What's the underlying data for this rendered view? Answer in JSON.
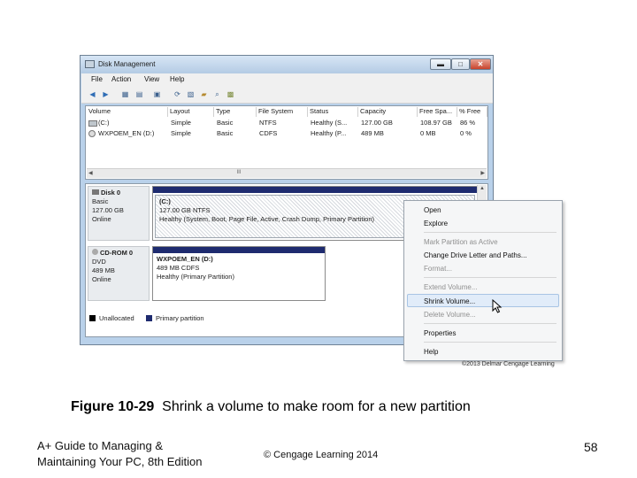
{
  "window": {
    "title": "Disk Management",
    "buttons": {
      "minimize": "▬",
      "maximize": "□",
      "close": "✕"
    }
  },
  "menu": [
    "File",
    "Action",
    "View",
    "Help"
  ],
  "toolbar_icons": [
    "back-icon",
    "forward-icon",
    "disk-list-icon",
    "properties-icon",
    "help-icon",
    "refresh-icon",
    "rescan-icon",
    "open-icon",
    "search-icon",
    "settings-icon"
  ],
  "volume_list": {
    "columns": [
      "Volume",
      "Layout",
      "Type",
      "File System",
      "Status",
      "Capacity",
      "Free Spa...",
      "% Free"
    ],
    "rows": [
      [
        "(C:)",
        "Simple",
        "Basic",
        "NTFS",
        "Healthy (S...",
        "127.00 GB",
        "108.97 GB",
        "86 %"
      ],
      [
        "WXPOEM_EN (D:)",
        "Simple",
        "Basic",
        "CDFS",
        "Healthy (P...",
        "489 MB",
        "0 MB",
        "0 %"
      ]
    ],
    "scroll_thumb": "III"
  },
  "disks": [
    {
      "name": "Disk 0",
      "type": "Basic",
      "size": "127.00 GB",
      "status": "Online",
      "volume": {
        "name": "(C:)",
        "size_fs": "127.00 GB NTFS",
        "health": "Healthy (System, Boot, Page File, Active, Crash Dump, Primary Partition)"
      }
    },
    {
      "name": "CD-ROM 0",
      "type": "DVD",
      "size": "489 MB",
      "status": "Online",
      "volume": {
        "name": "WXPOEM_EN (D:)",
        "size_fs": "489 MB CDFS",
        "health": "Healthy (Primary Partition)"
      }
    }
  ],
  "legend": [
    {
      "label": "Unallocated",
      "color": "#000000"
    },
    {
      "label": "Primary partition",
      "color": "#1e2b6f"
    }
  ],
  "context_menu": {
    "items": [
      {
        "label": "Open",
        "enabled": true
      },
      {
        "label": "Explore",
        "enabled": true
      },
      {
        "label": "Mark Partition as Active",
        "enabled": false
      },
      {
        "label": "Change Drive Letter and Paths...",
        "enabled": true
      },
      {
        "label": "Format...",
        "enabled": false
      },
      {
        "label": "Extend Volume...",
        "enabled": false
      },
      {
        "label": "Shrink Volume...",
        "enabled": true,
        "highlighted": true
      },
      {
        "label": "Delete Volume...",
        "enabled": false
      },
      {
        "label": "Properties",
        "enabled": true
      },
      {
        "label": "Help",
        "enabled": true
      }
    ]
  },
  "credit": "©2013 Delmar Cengage Learning",
  "caption": {
    "number": "Figure 10-29",
    "text": "Shrink a volume to make room for a new partition"
  },
  "footer": {
    "book_line1": "A+ Guide to Managing &",
    "book_line2": "Maintaining Your PC, 8th Edition",
    "copyright": "© Cengage Learning  2014",
    "page": "58"
  },
  "colors": {
    "primary_partition": "#1e2b6f",
    "window_frame": "#b9d1ea",
    "menu_highlight": "#e1ecf9"
  }
}
